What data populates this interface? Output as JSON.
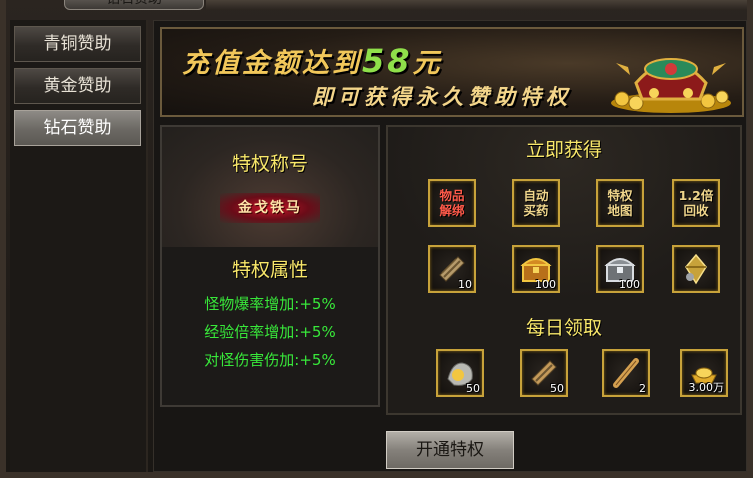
{
  "window": {
    "title": "钻石赞助"
  },
  "sidebar": {
    "items": [
      {
        "label": "青铜赞助",
        "active": false
      },
      {
        "label": "黄金赞助",
        "active": false
      },
      {
        "label": "钻石赞助",
        "active": true
      }
    ]
  },
  "banner": {
    "line1_prefix": "充值金额达到",
    "line1_amount": "58",
    "line1_suffix": "元",
    "line2": "即可获得永久赞助特权",
    "image_icon": "treasure-chest-gold-icon"
  },
  "privilege": {
    "title_heading": "特权称号",
    "rank_name": "金戈铁马",
    "attr_heading": "特权属性",
    "attributes": [
      "怪物爆率增加:+5%",
      "经验倍率增加:+5%",
      "对怪伤害伤加:+5%"
    ]
  },
  "instant": {
    "heading": "立即获得",
    "perks": [
      {
        "label_top": "物品",
        "label_bottom": "解绑",
        "color": "#ff5a4a"
      },
      {
        "label_top": "自动",
        "label_bottom": "买药",
        "color": "#f0d68c"
      },
      {
        "label_top": "特权",
        "label_bottom": "地图",
        "color": "#f0d68c"
      },
      {
        "label_top": "1.2倍",
        "label_bottom": "回收",
        "color": "#f0d68c"
      }
    ],
    "items": [
      {
        "icon": "scroll-bundle-icon",
        "count": "10"
      },
      {
        "icon": "gold-chest-icon",
        "count": "100"
      },
      {
        "icon": "silver-chest-icon",
        "count": "100"
      },
      {
        "icon": "gem-crystal-icon",
        "count": ""
      }
    ]
  },
  "daily": {
    "heading": "每日领取",
    "items": [
      {
        "icon": "gold-ore-icon",
        "count": "50"
      },
      {
        "icon": "scroll-bundle-icon",
        "count": "50"
      },
      {
        "icon": "magic-scroll-icon",
        "count": "2"
      },
      {
        "icon": "gold-ingot-icon",
        "count": "3.00万"
      }
    ]
  },
  "actions": {
    "open_label": "开通特权"
  },
  "colors": {
    "gold_text": "#f8e76a",
    "green_text": "#38e83a",
    "slot_border": "#c7a23a"
  }
}
